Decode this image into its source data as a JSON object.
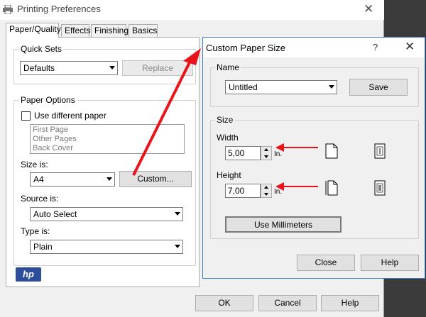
{
  "main_window": {
    "title": "Printing Preferences",
    "tabs": [
      "Paper/Quality",
      "Effects",
      "Finishing",
      "Basics"
    ],
    "quick_sets": {
      "legend": "Quick Sets",
      "value": "Defaults",
      "replace_label": "Replace"
    },
    "paper_options": {
      "legend": "Paper Options",
      "use_different_paper_label": "Use different paper",
      "pages": [
        "First Page",
        "Other Pages",
        "Back Cover"
      ],
      "size_label": "Size is:",
      "size_value": "A4",
      "custom_label": "Custom...",
      "source_label": "Source is:",
      "source_value": "Auto Select",
      "type_label": "Type is:",
      "type_value": "Plain"
    },
    "logo_text": "hp",
    "buttons": {
      "ok": "OK",
      "cancel": "Cancel",
      "help": "Help"
    }
  },
  "custom_dialog": {
    "title": "Custom Paper Size",
    "help_glyph": "?",
    "name_legend": "Name",
    "name_value": "Untitled",
    "save_label": "Save",
    "size_legend": "Size",
    "width_label": "Width",
    "width_value": "5,00",
    "height_label": "Height",
    "height_value": "7,00",
    "unit": "In.",
    "use_mm_label": "Use Millimeters",
    "close_label": "Close",
    "help_label": "Help"
  },
  "colors": {
    "accent_arrow": "#e8141a",
    "dialog_border": "#3a7fd5",
    "hp_logo": "#2c4d9a"
  }
}
